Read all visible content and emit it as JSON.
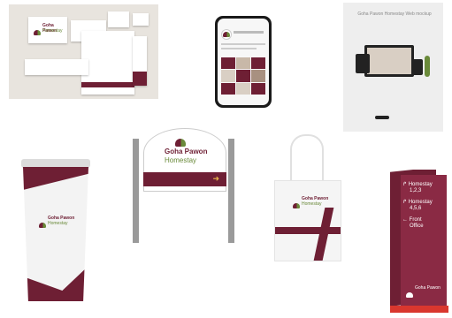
{
  "brand": {
    "name": "Goha Pawon",
    "subtitle": "Homestay",
    "colors": {
      "maroon": "#6e1f34",
      "green": "#6a8a3a"
    }
  },
  "web": {
    "title": "Goha Pawon Homestay Web mockup"
  },
  "direction_sign": {
    "rows": [
      {
        "arrow": "↱",
        "line1": "Homestay",
        "line2": "1,2,3"
      },
      {
        "arrow": "↱",
        "line1": "Homestay",
        "line2": "4,5,6"
      },
      {
        "arrow": "←",
        "line1": "Front",
        "line2": "Office"
      }
    ]
  }
}
